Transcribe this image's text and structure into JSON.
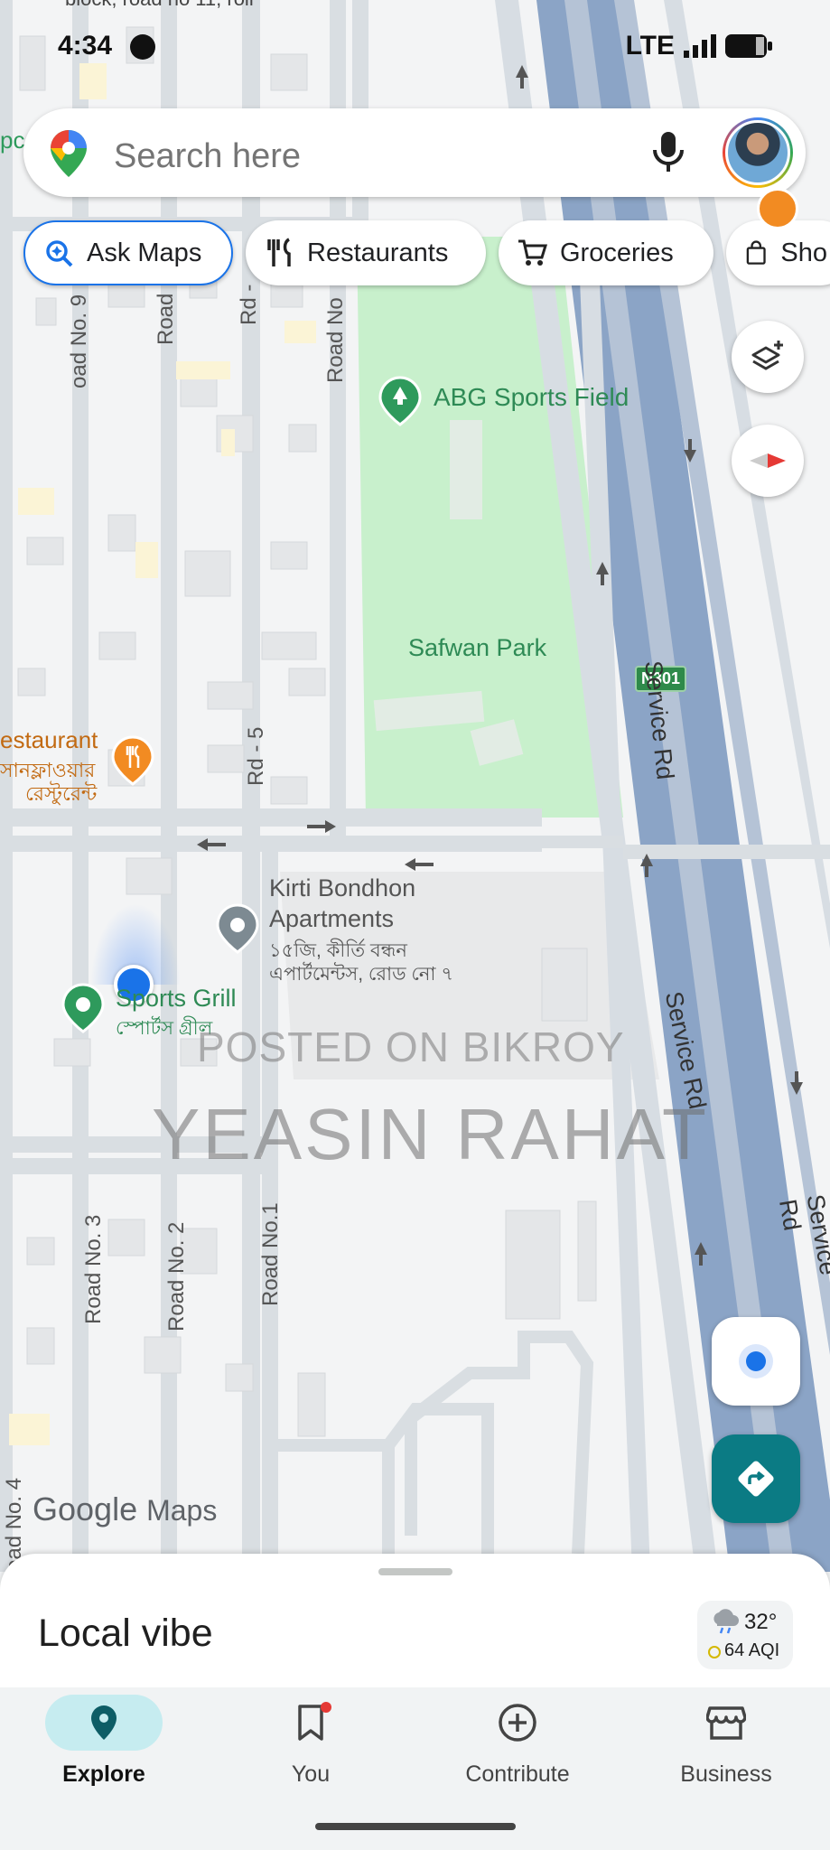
{
  "status_bar": {
    "time": "4:34",
    "network": "LTE"
  },
  "search": {
    "placeholder": "Search here"
  },
  "chips": [
    {
      "label": "Ask Maps",
      "icon": "ask-maps-sparkle-search-icon"
    },
    {
      "label": "Restaurants",
      "icon": "fork-knife-icon"
    },
    {
      "label": "Groceries",
      "icon": "shopping-cart-icon"
    },
    {
      "label": "Sho",
      "icon": "shopping-bag-icon"
    }
  ],
  "map_labels": {
    "abg_sports_field": "ABG Sports Field",
    "safwan_park": "Safwan Park",
    "n301": "N301",
    "service_rd": "Service Rd",
    "restaurant_en": "estaurant",
    "restaurant_bn_1": "সানফ্লাওয়ার",
    "restaurant_bn_2": "রেস্টুরেন্ট",
    "kirti_line1": "Kirti Bondhon",
    "kirti_line2": "Apartments",
    "kirti_bn_1": "১৫জি, কীর্তি বন্ধন",
    "kirti_bn_2": "এপার্টমেন্টস, রোড নো ৭",
    "sports_grill": "Sports Grill",
    "sports_grill_bn": "স্পোর্টস গ্রীল",
    "road_no_9": "oad No. 9",
    "road_top": "Road",
    "rd_top": "Rd -",
    "road_no_top": "Road No",
    "rd_5": "Rd - 5",
    "road_no_3": "Road No. 3",
    "road_no_2": "Road No. 2",
    "road_no_1": "Road No.1",
    "road_no_4": "oad No. 4",
    "top_fragment": "block, road no 11, roll",
    "left_fragment": "pc"
  },
  "watermark": {
    "line1": "POSTED ON BIKROY",
    "line2": "YEASIN RAHAT"
  },
  "brand": {
    "google": "Google",
    "maps": "Maps"
  },
  "sheet": {
    "title": "Local vibe",
    "temperature": "32°",
    "aqi": "64 AQI"
  },
  "nav": [
    {
      "label": "Explore",
      "icon": "location-pin-icon",
      "active": true
    },
    {
      "label": "You",
      "icon": "bookmark-icon",
      "active": false
    },
    {
      "label": "Contribute",
      "icon": "add-circle-icon",
      "active": false
    },
    {
      "label": "Business",
      "icon": "storefront-icon",
      "active": false
    }
  ],
  "colors": {
    "accent": "#1a73e8",
    "park": "#c8f0cc",
    "highway": "#8ba4c6",
    "teal": "#0b7b84",
    "orange": "#f28b22",
    "poi_green": "#2e9a5c"
  }
}
